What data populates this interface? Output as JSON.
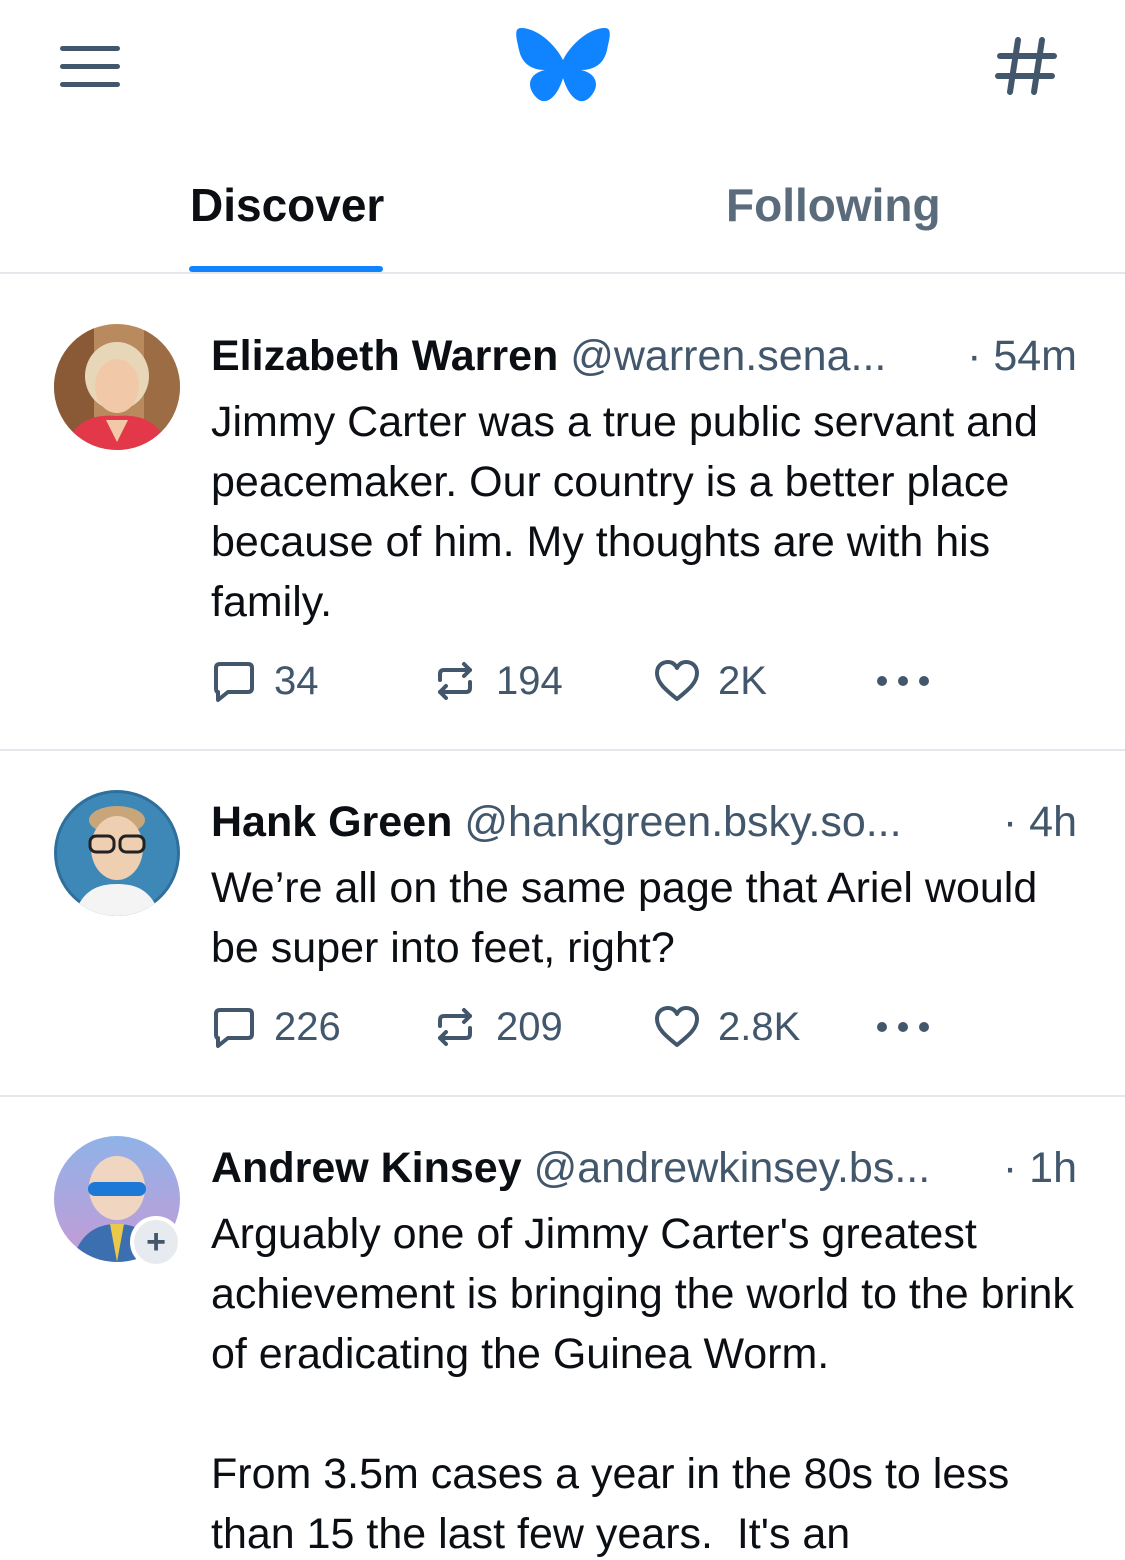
{
  "app": {
    "brand_color": "#1083fe",
    "icons": {
      "menu": "hamburger-menu-icon",
      "logo": "butterfly-logo-icon",
      "feeds": "hashtag-icon"
    }
  },
  "tabs": [
    {
      "label": "Discover",
      "active": true
    },
    {
      "label": "Following",
      "active": false
    }
  ],
  "posts": [
    {
      "author_name": "Elizabeth Warren",
      "handle": "@warren.sena...",
      "time": "· 54m",
      "text": "Jimmy Carter was a true public servant and peacemaker. Our country is a better place because of him. My thoughts are with his family.",
      "replies": "34",
      "reposts": "194",
      "likes": "2K"
    },
    {
      "author_name": "Hank Green",
      "handle": "@hankgreen.bsky.so...",
      "time": "· 4h",
      "text": "We’re all on the same page that Ariel would be super into feet, right?",
      "replies": "226",
      "reposts": "209",
      "likes": "2.8K"
    },
    {
      "author_name": "Andrew Kinsey",
      "handle": "@andrewkinsey.bs...",
      "time": "· 1h",
      "text": "Arguably one of Jimmy Carter's greatest achievement is bringing the world to the brink of eradicating the Guinea Worm.\n\nFrom 3.5m cases a year in the 80s to less than 15 the last few years.  It's an",
      "follow_badge": "+"
    }
  ]
}
